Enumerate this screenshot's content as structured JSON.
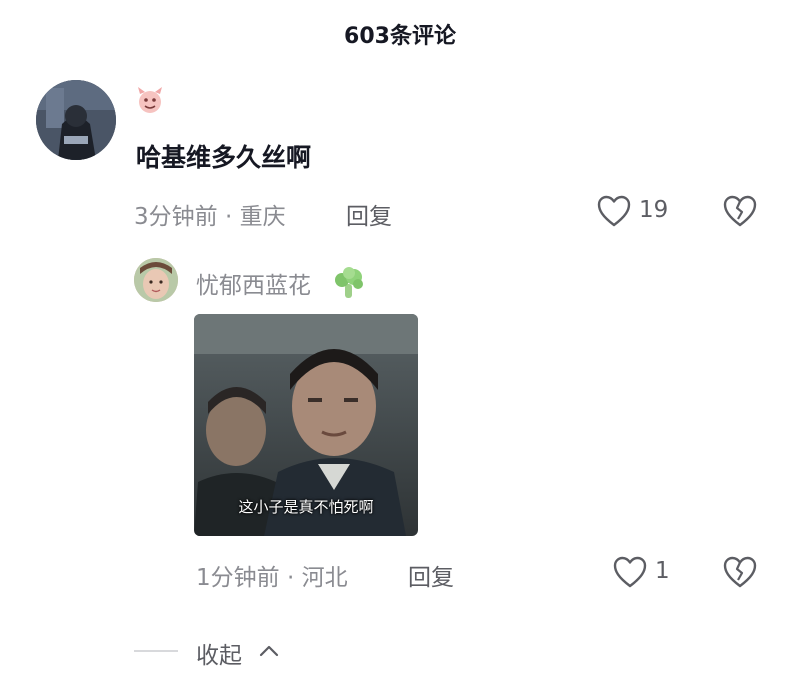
{
  "header": {
    "title": "603条评论"
  },
  "comment": {
    "text": "哈基维多久丝啊",
    "time_location": "3分钟前 · 重庆",
    "reply_label": "回复",
    "like_count": "19"
  },
  "reply": {
    "username": "忧郁西蓝花",
    "meme_caption": "这小子是真不怕死啊",
    "time_location": "1分钟前 · 河北",
    "reply_label": "回复",
    "like_count": "1"
  },
  "footer": {
    "collapse_label": "收起"
  },
  "icons": {
    "like": "heart-outline-icon",
    "dislike": "broken-heart-icon",
    "collapse": "chevron-up-icon",
    "badge": "pink-demon-emoji",
    "name_emoji": "broccoli-emoji"
  },
  "colors": {
    "text_primary": "#161823",
    "text_secondary": "#8a8b91",
    "text_action": "#5c5d63"
  }
}
